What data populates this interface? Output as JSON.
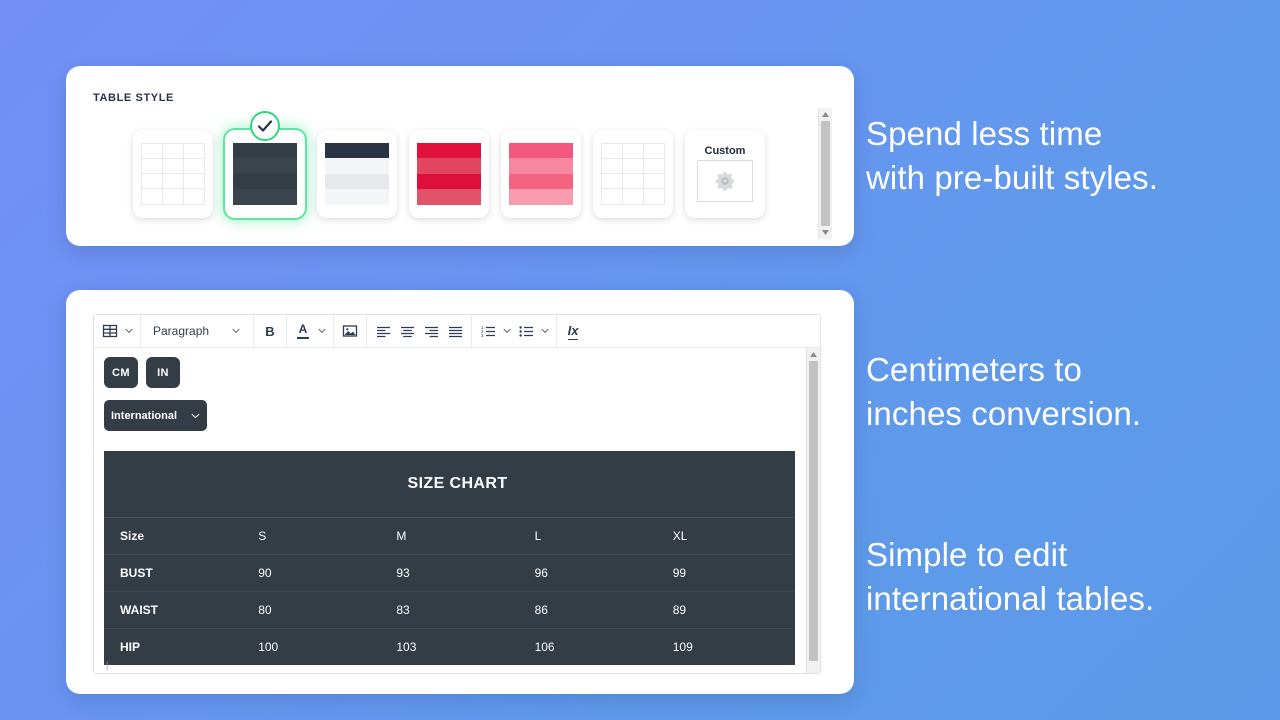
{
  "background": {
    "from": "#7290f7",
    "to": "#5b9ae8"
  },
  "style_panel": {
    "label": "TABLE STYLE",
    "swatches": [
      {
        "name": "plain-grid",
        "type": "grid",
        "selected": false
      },
      {
        "name": "dark-solid",
        "type": "stripes",
        "selected": true,
        "colors": [
          "#343c46",
          "#3b434d",
          "#343c46",
          "#3b434d"
        ]
      },
      {
        "name": "dark-header-light-rows",
        "type": "stripes",
        "selected": false,
        "colors": [
          "#2b3442",
          "#f4f5f7",
          "#e7e9ec",
          "#f4f5f7"
        ]
      },
      {
        "name": "crimson-stripes",
        "type": "stripes",
        "selected": false,
        "colors": [
          "#e0123c",
          "#e2465f",
          "#dd0f3b",
          "#e2536a"
        ]
      },
      {
        "name": "pink-stripes",
        "type": "stripes",
        "selected": false,
        "colors": [
          "#f2587c",
          "#f7879f",
          "#f4637f",
          "#f79cae"
        ]
      },
      {
        "name": "plain-grid-2",
        "type": "grid",
        "selected": false
      },
      {
        "name": "custom",
        "type": "custom",
        "selected": false,
        "label": "Custom",
        "icon": "gear-icon"
      }
    ],
    "scrollbar": {
      "up_icon": "triangle-up-icon",
      "down_icon": "triangle-down-icon"
    }
  },
  "editor": {
    "toolbar": {
      "table_icon": "table-icon",
      "block_format": "Paragraph",
      "bold_label": "B",
      "font_color_label": "A",
      "image_icon": "image-icon",
      "align": [
        "align-left-icon",
        "align-center-icon",
        "align-right-icon",
        "align-justify-icon"
      ],
      "ordered_list_icon": "ordered-list-icon",
      "unordered_list_icon": "unordered-list-icon",
      "clear_format_label": "Ix",
      "caret_icon": "chevron-down-icon"
    },
    "units": {
      "cm": "CM",
      "in": "IN"
    },
    "region": {
      "value": "International",
      "caret": "chevron-down-icon"
    },
    "scrollbar": {
      "up_icon": "triangle-up-icon"
    }
  },
  "chart_data": {
    "type": "table",
    "title": "SIZE CHART",
    "columns": [
      "Size",
      "S",
      "M",
      "L",
      "XL"
    ],
    "rows": [
      {
        "label": "BUST",
        "values": [
          "90",
          "93",
          "96",
          "99"
        ]
      },
      {
        "label": "WAIST",
        "values": [
          "80",
          "83",
          "86",
          "89"
        ]
      },
      {
        "label": "HIP",
        "values": [
          "100",
          "103",
          "106",
          "109"
        ]
      }
    ],
    "unit": "CM",
    "region": "International"
  },
  "promos": [
    "Spend less time\nwith pre-built styles.",
    "Centimeters to\ninches conversion.",
    "Simple to edit\ninternational tables."
  ]
}
